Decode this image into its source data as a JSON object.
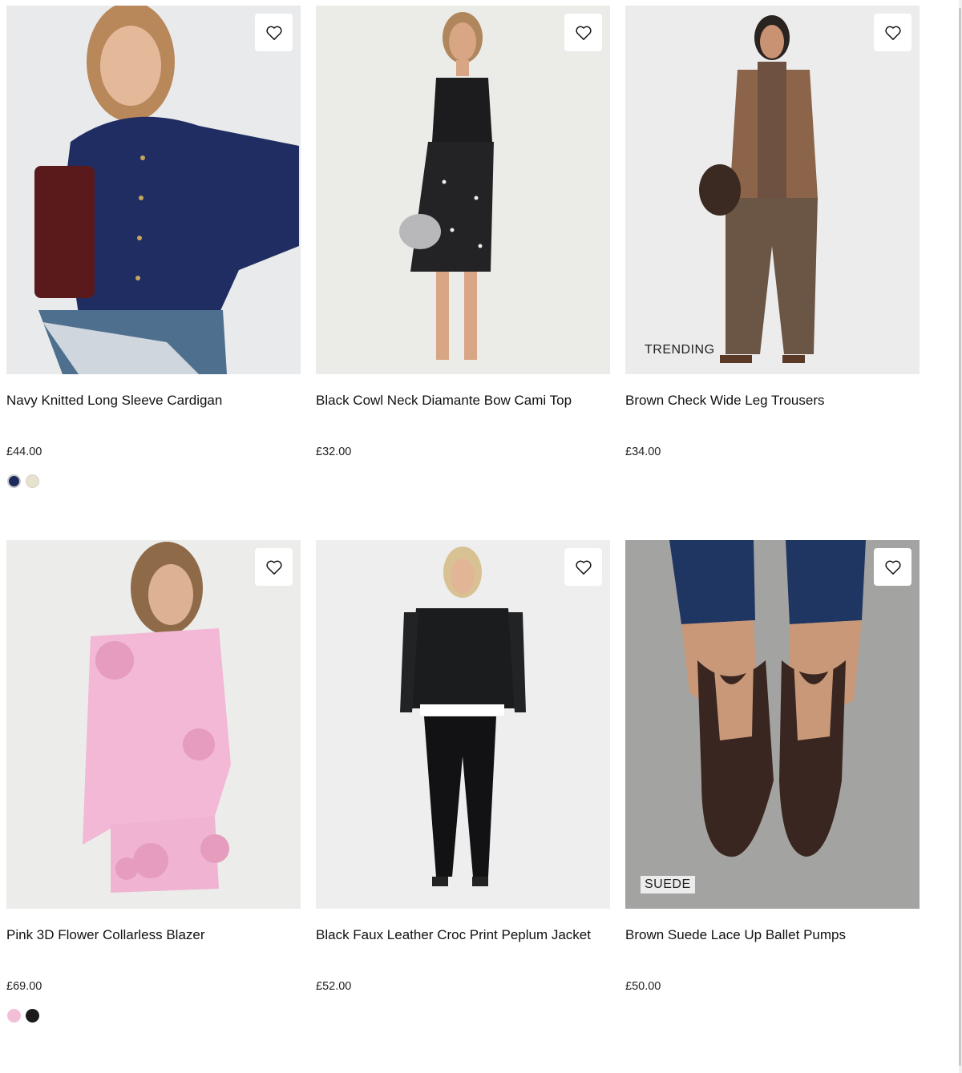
{
  "products": [
    {
      "name": "Navy Knitted Long Sleeve Cardigan",
      "price": "£44.00",
      "badge": "",
      "swatches": [
        "#1d2a5c",
        "#e7e2cf"
      ]
    },
    {
      "name": "Black Cowl Neck Diamante Bow Cami Top",
      "price": "£32.00",
      "badge": "",
      "swatches": []
    },
    {
      "name": "Brown Check Wide Leg Trousers",
      "price": "£34.00",
      "badge": "TRENDING",
      "swatches": []
    },
    {
      "name": "Pink 3D Flower Collarless Blazer",
      "price": "£69.00",
      "badge": "",
      "swatches": [
        "#f3bfd8",
        "#1b1b1b"
      ]
    },
    {
      "name": "Black Faux Leather Croc Print Peplum Jacket",
      "price": "£52.00",
      "badge": "",
      "swatches": []
    },
    {
      "name": "Brown Suede Lace Up Ballet Pumps",
      "price": "£50.00",
      "badge": "SUEDE",
      "swatches": []
    }
  ],
  "icons": {
    "wishlist": "heart-outline-icon"
  },
  "colors": {
    "image_bg": "#ececec",
    "text": "#111111",
    "badge_bg": "#ececec"
  }
}
